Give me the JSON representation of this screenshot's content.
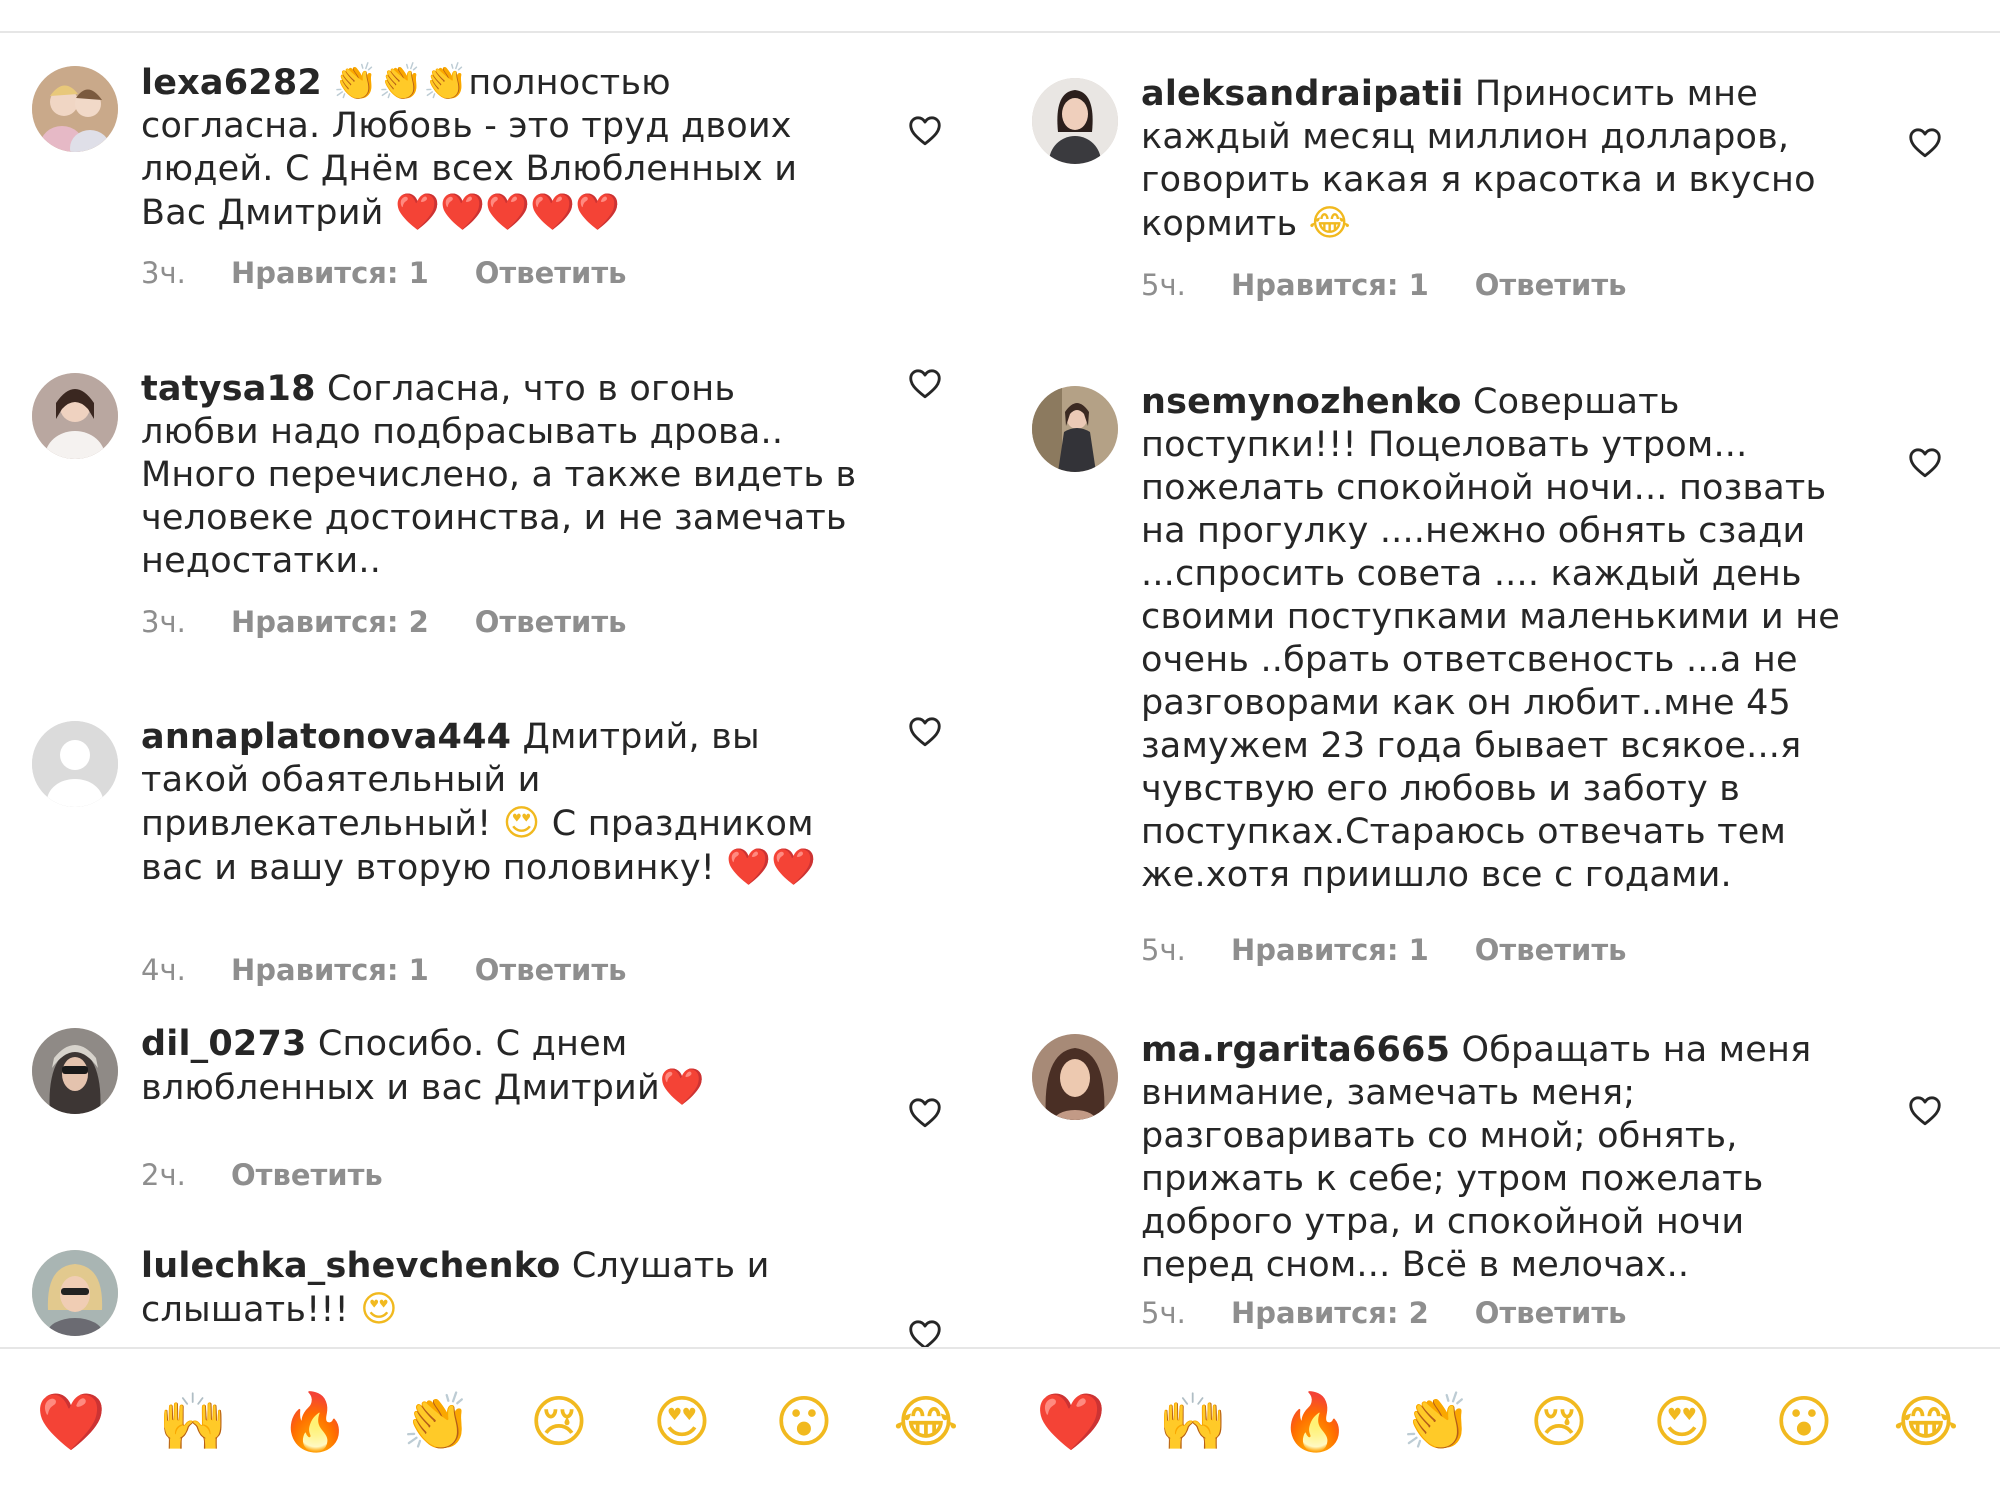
{
  "comments_left": [
    {
      "username": "lexa6282",
      "text_segments": [
        " ",
        "👏👏👏",
        "полностью согласна. Любовь - это труд двоих людей. С Днём всех Влюбленных и Вас Дмитрий ",
        "❤️❤️❤️❤️❤️"
      ],
      "time": "3ч.",
      "likes": "Нравится: 1",
      "reply": "Ответить"
    },
    {
      "username": "tatysa18",
      "text_segments": [
        " Согласна, что в огонь любви надо подбрасывать дрова.. Много перечислено, а также видеть в человеке достоинства, и не замечать недостатки.."
      ],
      "time": "3ч.",
      "likes": "Нравится: 2",
      "reply": "Ответить"
    },
    {
      "username": "annaplatonova444",
      "text_segments": [
        " Дмитрий, вы такой обаятельный и привлекательный! ",
        "😍",
        " С праздником вас и вашу вторую половинку! ",
        "❤️❤️"
      ],
      "time": "4ч.",
      "likes": "Нравится: 1",
      "reply": "Ответить"
    },
    {
      "username": "dil_0273",
      "text_segments": [
        " Спосибо. С днем влюбленных и вас Дмитрий",
        "❤️"
      ],
      "time": "2ч.",
      "reply": "Ответить"
    },
    {
      "username": "lulechka_shevchenko",
      "text_segments": [
        " Слушать и слышать!!! ",
        "😍"
      ]
    }
  ],
  "comments_right": [
    {
      "username": "aleksandraipatii",
      "text_segments": [
        " Приносить мне каждый месяц миллион долларов, говорить какая я красотка и  вкусно кормить ",
        "😂"
      ],
      "time": "5ч.",
      "likes": "Нравится: 1",
      "reply": "Ответить"
    },
    {
      "username": "nsemynozhenko",
      "text_segments": [
        " Совершать поступки!!! Поцеловать утром... пожелать спокойной ночи... позвать на прогулку ....нежно обнять сзади ...спросить совета .... каждый день своими поступками маленькими и не очень ..брать ответсвеность ...а не разговорами как он любит..мне 45 замужем 23 года бывает всякое...я чувствую его любовь и заботу в поступках.Стараюсь отвечать тем же.хотя приишло все с годами."
      ],
      "time": "5ч.",
      "likes": "Нравится: 1",
      "reply": "Ответить"
    },
    {
      "username": "ma.rgarita6665",
      "text_segments": [
        " Обращать на меня внимание, замечать меня; разговаривать со мной; обнять, прижать к себе; утром пожелать доброго утра, и спокойной ночи перед сном... Всё в мелочах.."
      ],
      "time": "5ч.",
      "likes": "Нравится: 2",
      "reply": "Ответить"
    }
  ],
  "reactions": [
    "❤️",
    "🙌",
    "🔥",
    "👏",
    "😢",
    "😍",
    "😮",
    "😂",
    "❤️",
    "🙌",
    "🔥",
    "👏",
    "😢",
    "😍",
    "😮",
    "😂"
  ],
  "icons": {
    "like": "heart-outline-icon",
    "avatar_placeholder": "default-user-icon"
  },
  "colors": {
    "text": "#262626",
    "meta": "#8e8e8e",
    "divider": "#e6e6e6",
    "heart_outline": "#262626"
  }
}
